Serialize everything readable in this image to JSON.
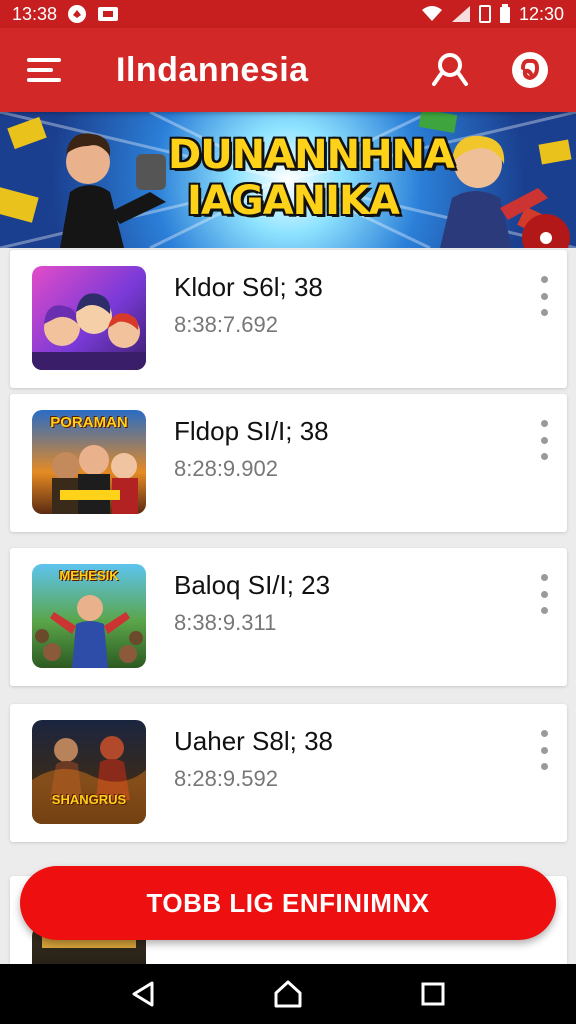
{
  "status_bar": {
    "time_left": "13:38",
    "time_right": "12:30"
  },
  "app_bar": {
    "title": "Ilndannesia",
    "menu_icon": "hamburger-menu-icon",
    "search_icon": "search-icon",
    "profile_icon": "account-icon"
  },
  "banner": {
    "title_line1": "DUNANNHNA",
    "title_line2": "IAGANIKA"
  },
  "items": [
    {
      "title": "Kldor S6l; 38",
      "subtitle": "8:38:7.692",
      "thumb_text": ""
    },
    {
      "title": "Fldop SI/I; 38",
      "subtitle": "8:28:9.902",
      "thumb_text": "PORAMAN"
    },
    {
      "title": "Baloq SI/I; 23",
      "subtitle": "8:38:9.311",
      "thumb_text": "MEHESIK"
    },
    {
      "title": "Uaher S8l; 38",
      "subtitle": "8:28:9.592",
      "thumb_text": "SHANGRUS"
    }
  ],
  "cta": {
    "label": "TOBB LIG ENFINIMNX"
  },
  "colors": {
    "primary": "#d32828",
    "cta": "#ee1010",
    "status": "#c71f1f"
  },
  "nav": {
    "back_icon": "back-icon",
    "home_icon": "home-icon",
    "recents_icon": "recents-icon"
  }
}
